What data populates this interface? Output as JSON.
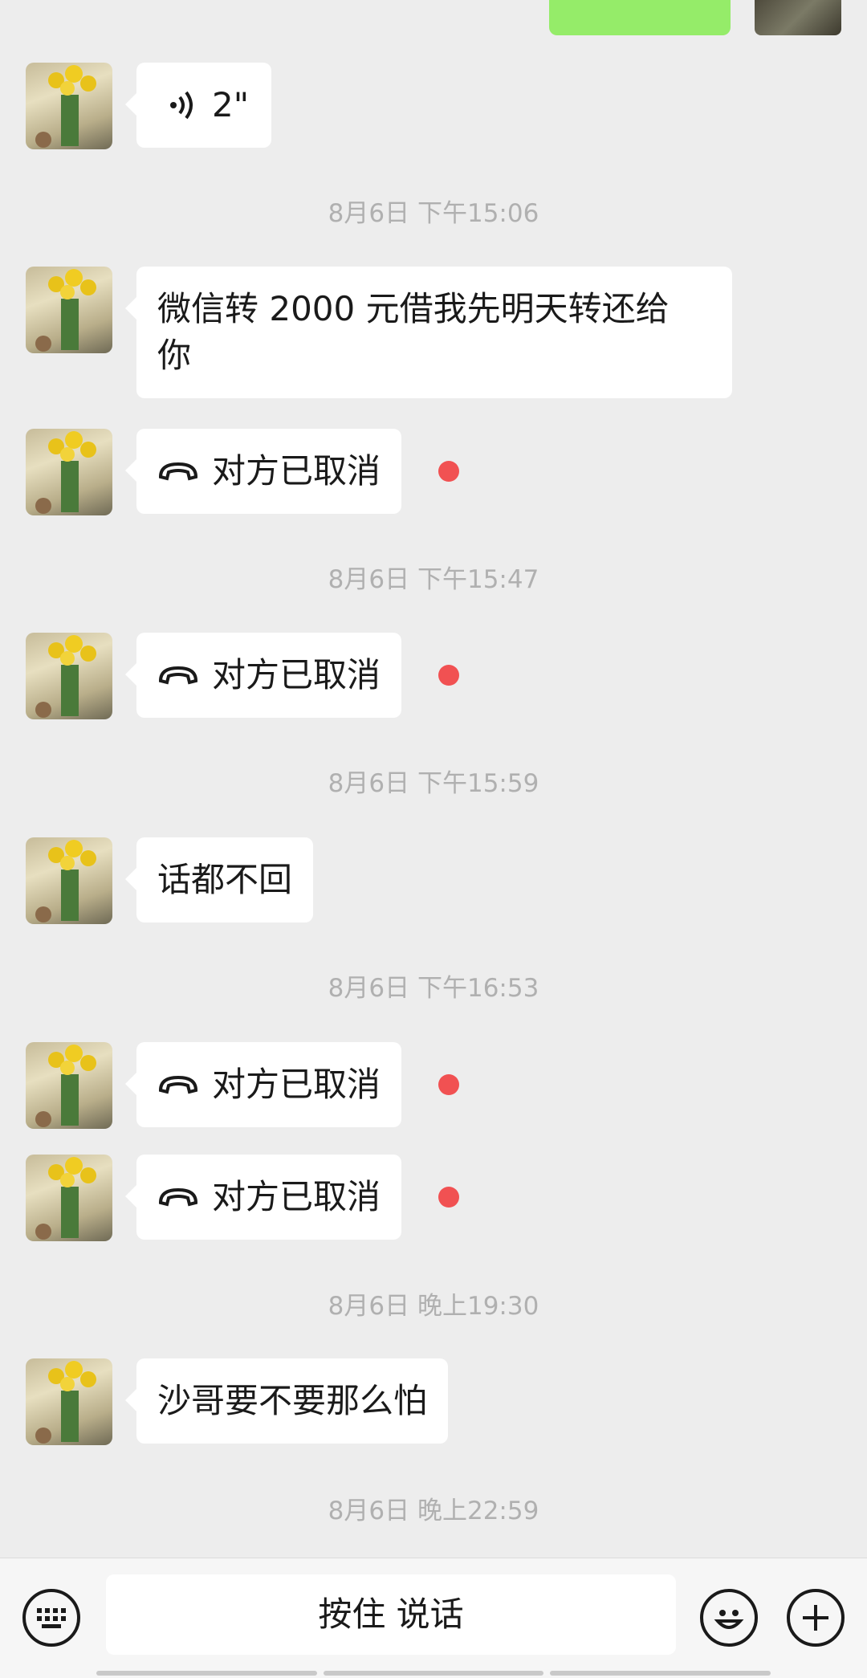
{
  "messages": {
    "voice_duration": "2\"",
    "ts1": "8月6日 下午15:06",
    "msg_borrow_line1": "微信转 2000 元借我先明天转还给",
    "msg_borrow_line2": "你",
    "call_cancelled_1": "对方已取消",
    "ts2": "8月6日 下午15:47",
    "call_cancelled_2": "对方已取消",
    "ts3": "8月6日 下午15:59",
    "msg_no_reply": "话都不回",
    "ts4": "8月6日 下午16:53",
    "call_cancelled_3": "对方已取消",
    "call_cancelled_4": "对方已取消",
    "ts5": "8月6日 晚上19:30",
    "msg_afraid": "沙哥要不要那么怕",
    "ts6": "8月6日 晚上22:59"
  },
  "input_bar": {
    "hold_to_talk": "按住 说话"
  },
  "colors": {
    "background": "#ededed",
    "bubble_self": "#95ec69",
    "bubble_other": "#ffffff",
    "unread_dot": "#f15152",
    "timestamp": "#b0b0b0"
  },
  "icons": [
    "voice-icon",
    "call-cancelled-icon",
    "keyboard-icon",
    "emoji-icon",
    "plus-icon",
    "unread-dot"
  ]
}
